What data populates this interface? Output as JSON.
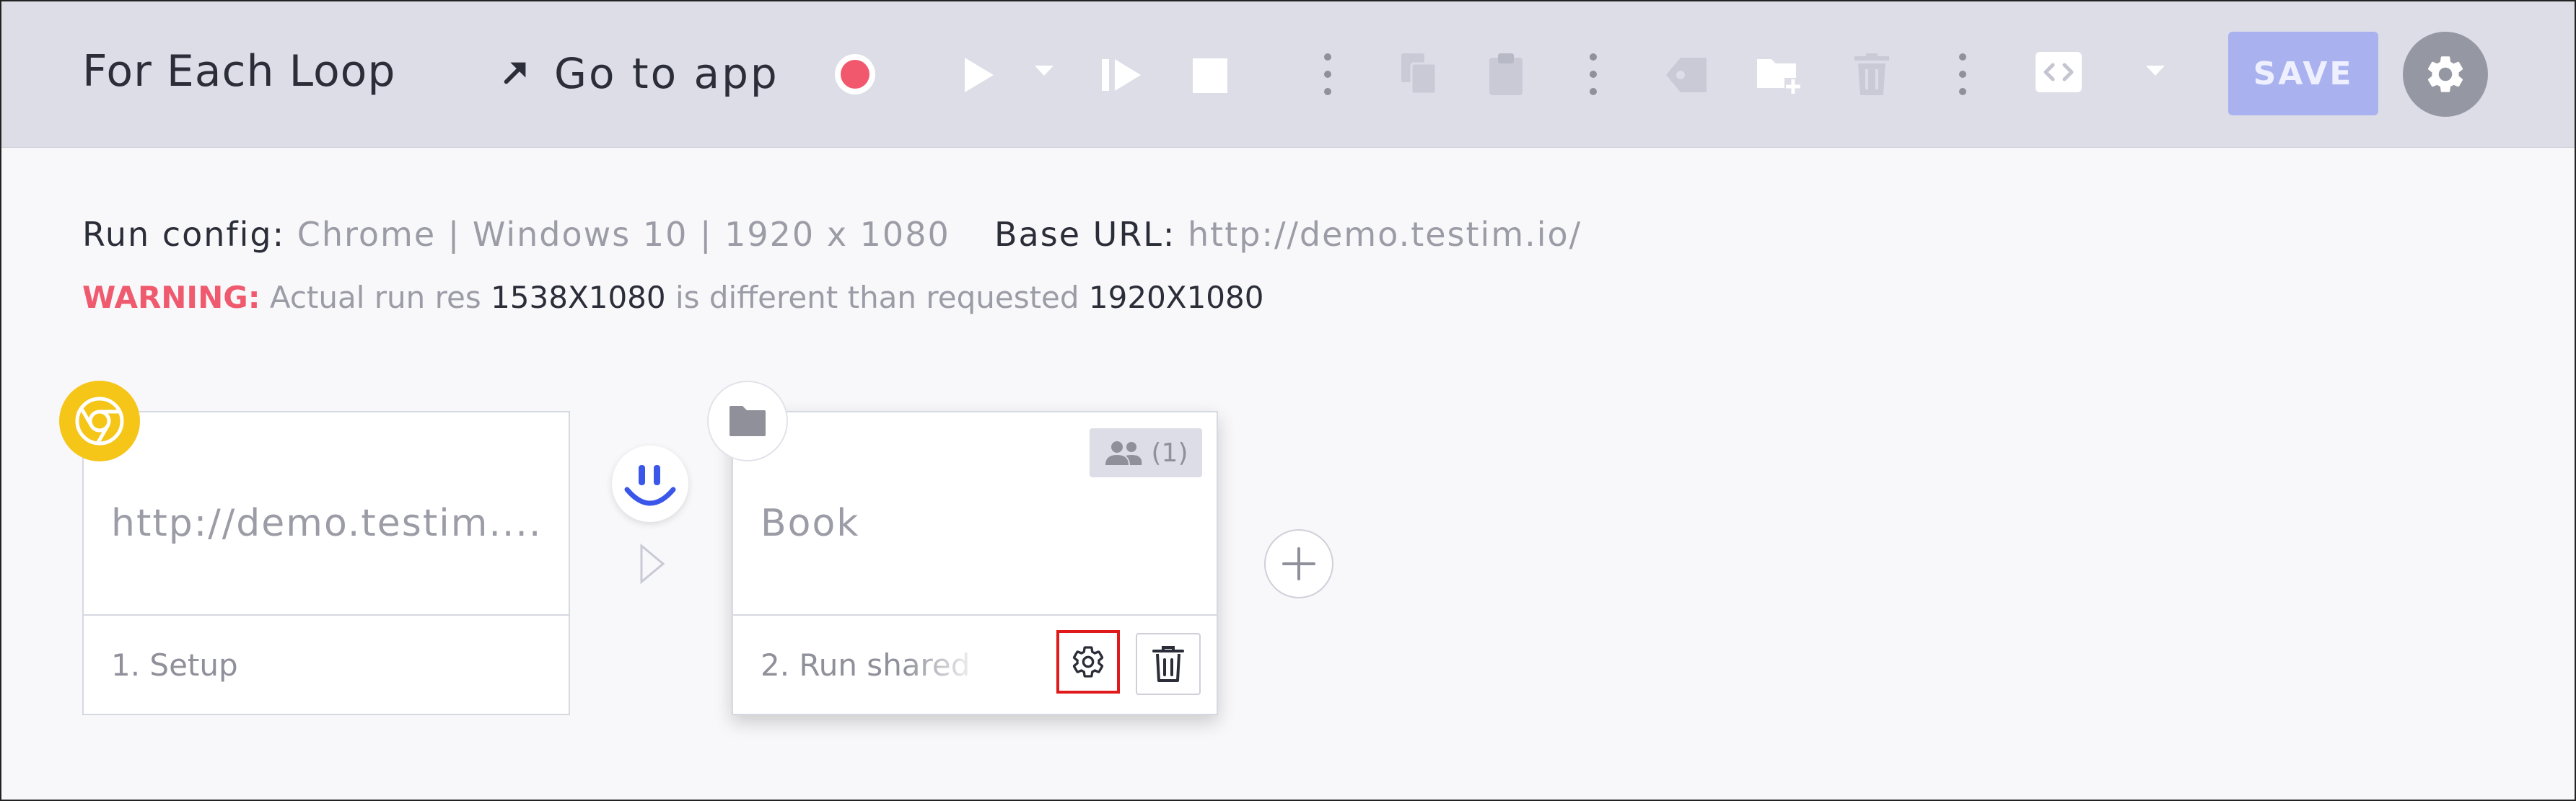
{
  "toolbar": {
    "title": "For Each Loop",
    "go_to_app_label": "Go to app",
    "save_label": "SAVE",
    "icons": [
      "go-to-app-arrow-icon",
      "record-icon",
      "play-icon",
      "play-dropdown-icon",
      "step-forward-icon",
      "stop-icon",
      "more-vertical-icon",
      "copy-icon",
      "paste-icon",
      "more-vertical-icon",
      "tag-icon",
      "add-folder-icon",
      "delete-icon",
      "more-vertical-icon",
      "code-icon",
      "code-dropdown-icon",
      "settings-gear-icon"
    ]
  },
  "run_config": {
    "label": "Run config:",
    "value": "Chrome | Windows 10 | 1920 x 1080",
    "base_url_label": "Base URL:",
    "base_url_value": "http://demo.testim.io/"
  },
  "warning": {
    "label": "WARNING:",
    "text1": "Actual run res",
    "actual": "1538X1080",
    "text2": "is different than requested",
    "requested": "1920X1080"
  },
  "steps": [
    {
      "title": "http://demo.testim....",
      "footer": "1. Setup",
      "badge_icon": "chrome-icon"
    },
    {
      "title": "Book",
      "footer": "2. Run shared",
      "badge_icon": "folder-icon",
      "shared_count": "(1)"
    }
  ],
  "colors": {
    "toolbar_bg": "#dcdde7",
    "canvas_bg": "#f8f8fa",
    "record": "#f2586d",
    "save_bg": "#a9b2ef",
    "warning": "#ef5a6f",
    "chrome_badge": "#f5c518",
    "pause_accent": "#3a57ea",
    "highlight": "#e01a1a"
  }
}
